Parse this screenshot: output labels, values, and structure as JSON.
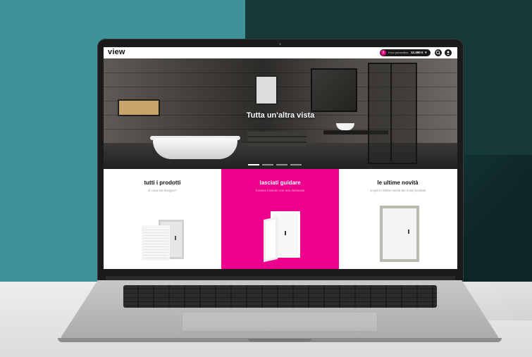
{
  "site": {
    "logo": "view"
  },
  "header": {
    "budget_label": "Il tuo preventivo",
    "budget_amount": "12.490 €",
    "budget_chevron": "▾",
    "budget_badge": "5",
    "search_icon": "search-icon",
    "account_icon": "user-icon"
  },
  "hero": {
    "title": "Tutta un'altra vista",
    "slides": 4,
    "active_slide": 1
  },
  "cards": [
    {
      "title": "tutti i prodotti",
      "subtitle": "di cosa hai bisogno?",
      "background": "#ffffff"
    },
    {
      "title": "lasciati guidare",
      "subtitle": "trovano insieme con una domanda",
      "background": "#ec008c"
    },
    {
      "title": "le ultime novità",
      "subtitle": "scopri le ultime novità dei nostri prodotti",
      "background": "#ffffff"
    }
  ],
  "colors": {
    "accent": "#ec008c",
    "backdrop_teal": "#3e9299",
    "backdrop_dark": "#163a3a"
  }
}
